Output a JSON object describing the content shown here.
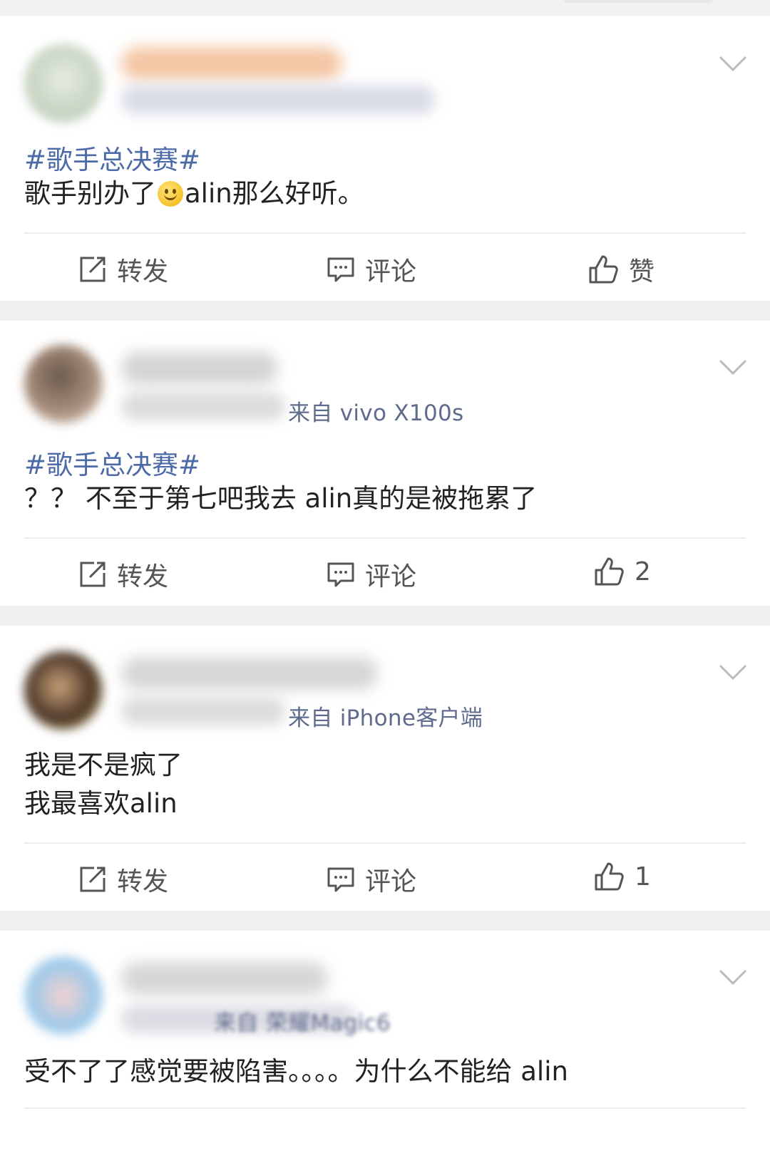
{
  "actions": {
    "repost": "转发",
    "comment": "评论"
  },
  "posts": [
    {
      "topic": "#歌手总决赛#",
      "text_before_emoji": "歌手别办了",
      "text_after_emoji": "alin那么好听。",
      "source": "",
      "like_label": "赞"
    },
    {
      "topic": "#歌手总决赛#",
      "text": "？？ 不至于第七吧我去  alin真的是被拖累了",
      "source": "来自 vivo X100s",
      "like_label": "2"
    },
    {
      "topic": "",
      "text_line1": "我是不是疯了",
      "text_line2": "我最喜欢alin",
      "source": "来自 iPhone客户端",
      "like_label": "1"
    },
    {
      "topic": "",
      "text": "受不了了感觉要被陷害。。。。为什么不能给 alin",
      "source": "来自 荣耀Magic6",
      "like_label": ""
    }
  ],
  "colors": {
    "topic": "#4d6aa8",
    "text": "#222222",
    "action": "#555555",
    "background": "#f2f2f2"
  },
  "icons": [
    "repost-icon",
    "comment-icon",
    "like-icon",
    "chevron-down-icon",
    "smiley-emoji-icon"
  ]
}
